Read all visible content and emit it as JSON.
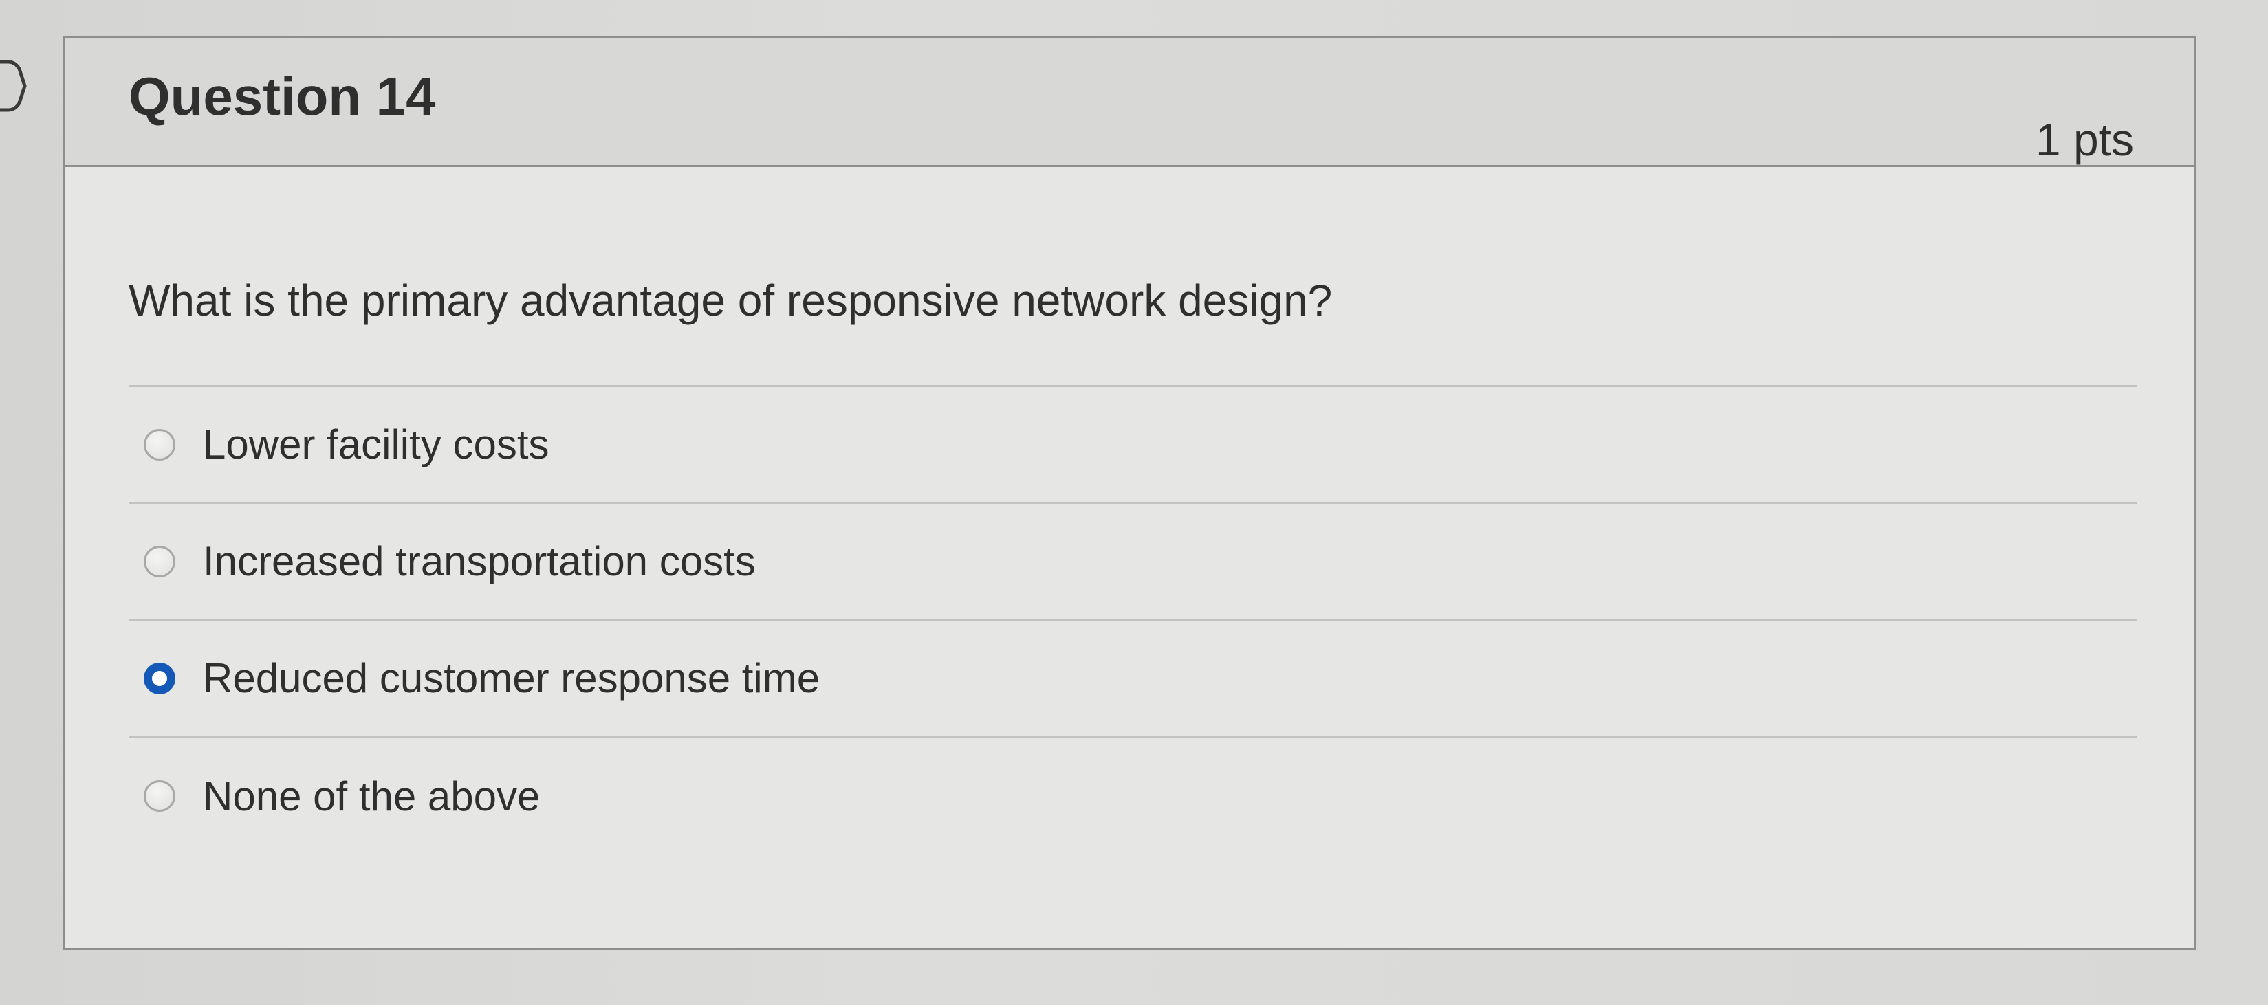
{
  "question": {
    "title": "Question 14",
    "points": "1 pts",
    "text": "What is the primary advantage of responsive network design?"
  },
  "answers": [
    {
      "label": "Lower facility costs",
      "selected": false
    },
    {
      "label": "Increased transportation costs",
      "selected": false
    },
    {
      "label": "Reduced customer response time",
      "selected": true
    },
    {
      "label": "None of the above",
      "selected": false
    }
  ],
  "colors": {
    "accent": "#1458b8",
    "text": "#2f2f2f",
    "border": "#8e8e8c"
  },
  "icons": {
    "flag": "chevron-right-icon"
  }
}
